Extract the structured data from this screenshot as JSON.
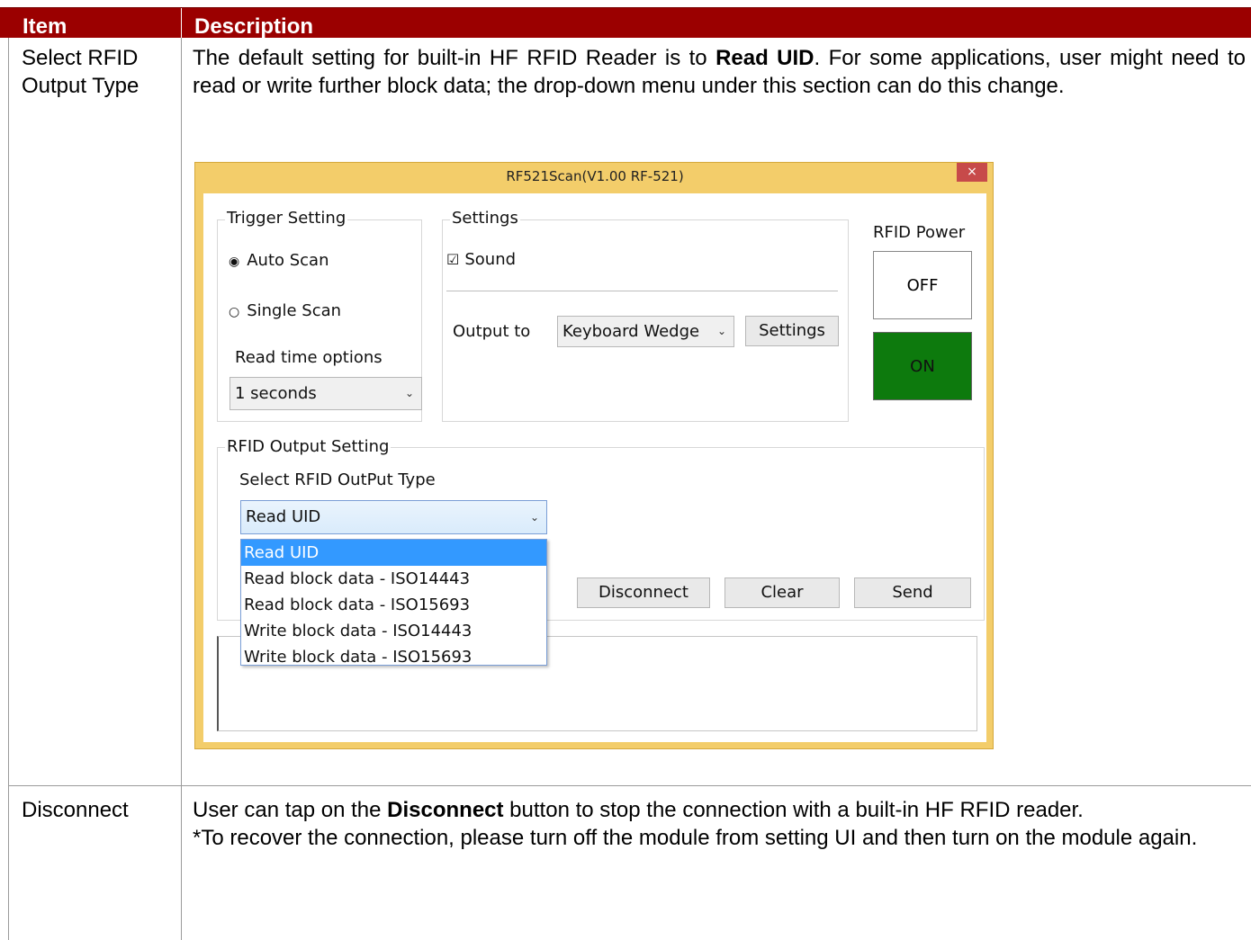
{
  "table": {
    "headers": {
      "item": "Item",
      "description": "Description"
    },
    "rows": [
      {
        "item": "Select RFID Output Type",
        "desc_part1": "The default setting for built-in HF RFID Reader is to ",
        "desc_bold": "Read UID",
        "desc_part2": ". For some applications, user might need to read or write further block data; the drop-down menu under this section can do this change."
      },
      {
        "item": "Disconnect",
        "desc_part1": "User can tap on the ",
        "desc_bold": "Disconnect",
        "desc_part2": " button to stop the connection with a built-in HF RFID reader.",
        "desc_note": "*To recover the connection, please turn off the module from setting UI and then turn on the module again."
      }
    ]
  },
  "app": {
    "title": "RF521Scan(V1.00 RF-521)",
    "close_glyph": "×",
    "trigger_setting": {
      "label": "Trigger Setting",
      "auto_scan": "Auto Scan",
      "single_scan": "Single Scan",
      "read_time_label": "Read time options",
      "read_time_value": "1 seconds",
      "auto_scan_selected": true
    },
    "settings": {
      "label": "Settings",
      "sound": "Sound",
      "sound_checked": true,
      "output_to_label": "Output to",
      "output_to_value": "Keyboard Wedge",
      "settings_button": "Settings"
    },
    "rfid_power": {
      "label": "RFID Power",
      "off": "OFF",
      "on": "ON",
      "on_color": "#0d7a0d"
    },
    "rfid_output": {
      "label": "RFID Output Setting",
      "select_label": "Select RFID OutPut Type",
      "selected_value": "Read UID",
      "options": [
        "Read UID",
        "Read block data - ISO14443",
        "Read block data - ISO15693",
        "Write block data - ISO14443",
        "Write block data - ISO15693"
      ],
      "disconnect_button": "Disconnect",
      "clear_button": "Clear",
      "send_button": "Send"
    },
    "glyphs": {
      "radio_on": "◉",
      "radio_off": "○",
      "checkbox_checked": "☑",
      "chevron": "⌄"
    }
  },
  "colors": {
    "header_bg": "#9b0000",
    "window_frame": "#f3cd6a",
    "close_button": "#c74a4a",
    "selection": "#3399ff"
  }
}
